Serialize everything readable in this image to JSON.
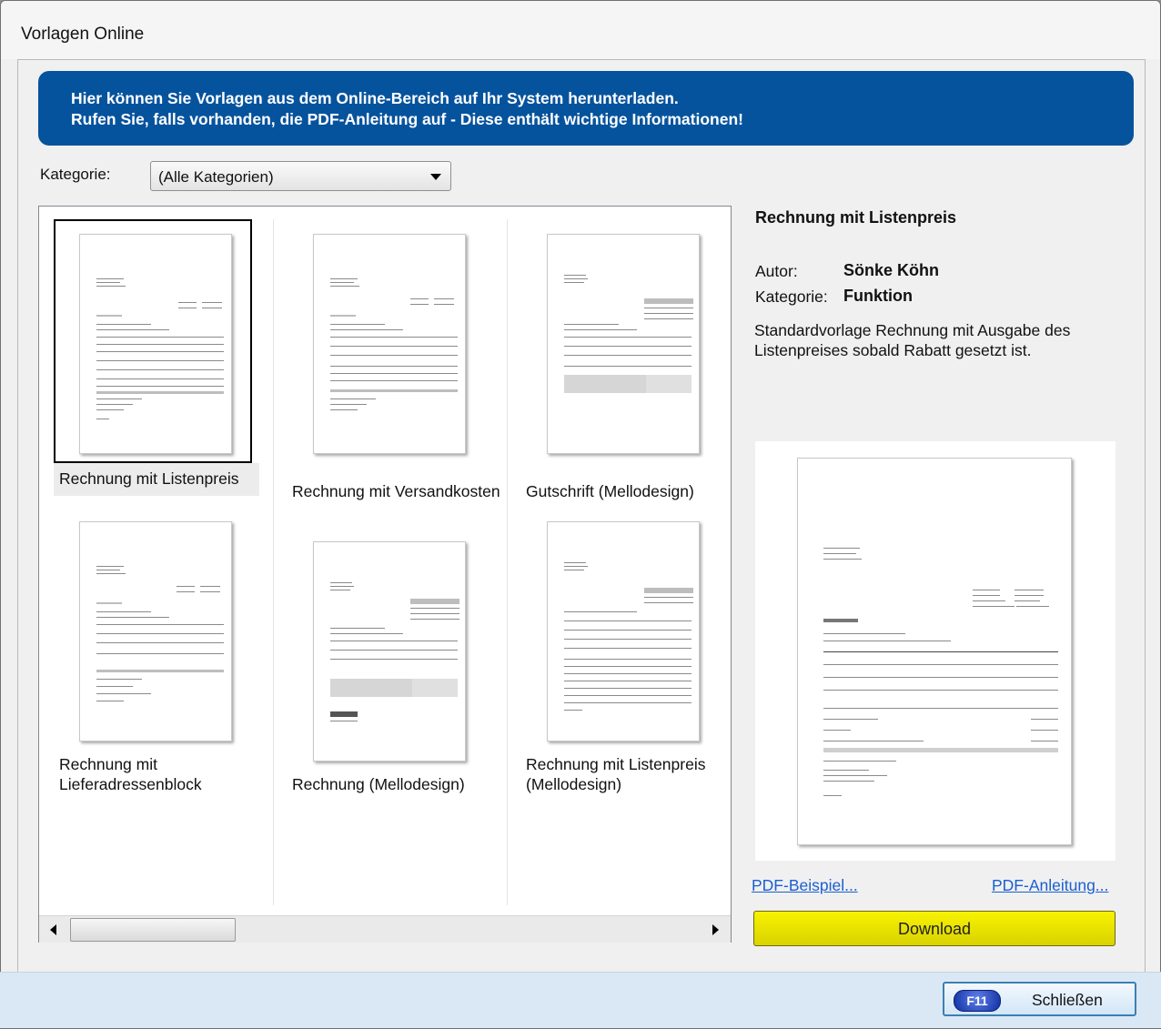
{
  "window": {
    "title": "Vorlagen Online"
  },
  "banner": {
    "line1": "Hier können Sie Vorlagen aus dem Online-Bereich auf Ihr System herunterladen.",
    "line2": "Rufen Sie, falls vorhanden, die PDF-Anleitung auf - Diese enthält wichtige Informationen!"
  },
  "category": {
    "label": "Kategorie:",
    "selected": "(Alle Kategorien)"
  },
  "templates": [
    {
      "name": "Rechnung mit Listenpreis",
      "selected": true
    },
    {
      "name": "Rechnung mit Versandkosten"
    },
    {
      "name": "Gutschrift (Mellodesign)"
    },
    {
      "name": "Rechnung mit Lieferadressenblock"
    },
    {
      "name": "Rechnung (Mellodesign)"
    },
    {
      "name": "Rechnung mit Listenpreis (Mellodesign)"
    }
  ],
  "detail": {
    "title": "Rechnung mit Listenpreis",
    "author_label": "Autor:",
    "author": "Sönke Köhn",
    "category_label": "Kategorie:",
    "category": "Funktion",
    "description": "Standardvorlage Rechnung mit Ausgabe des Listenpreises sobald Rabatt gesetzt ist."
  },
  "links": {
    "pdf_example": "PDF-Beispiel...",
    "pdf_manual": "PDF-Anleitung..."
  },
  "buttons": {
    "download": "Download",
    "close": "Schließen",
    "close_hotkey": "F11"
  },
  "colors": {
    "banner": "#06539d",
    "download": "#e8e200",
    "link": "#1a5fd0"
  }
}
